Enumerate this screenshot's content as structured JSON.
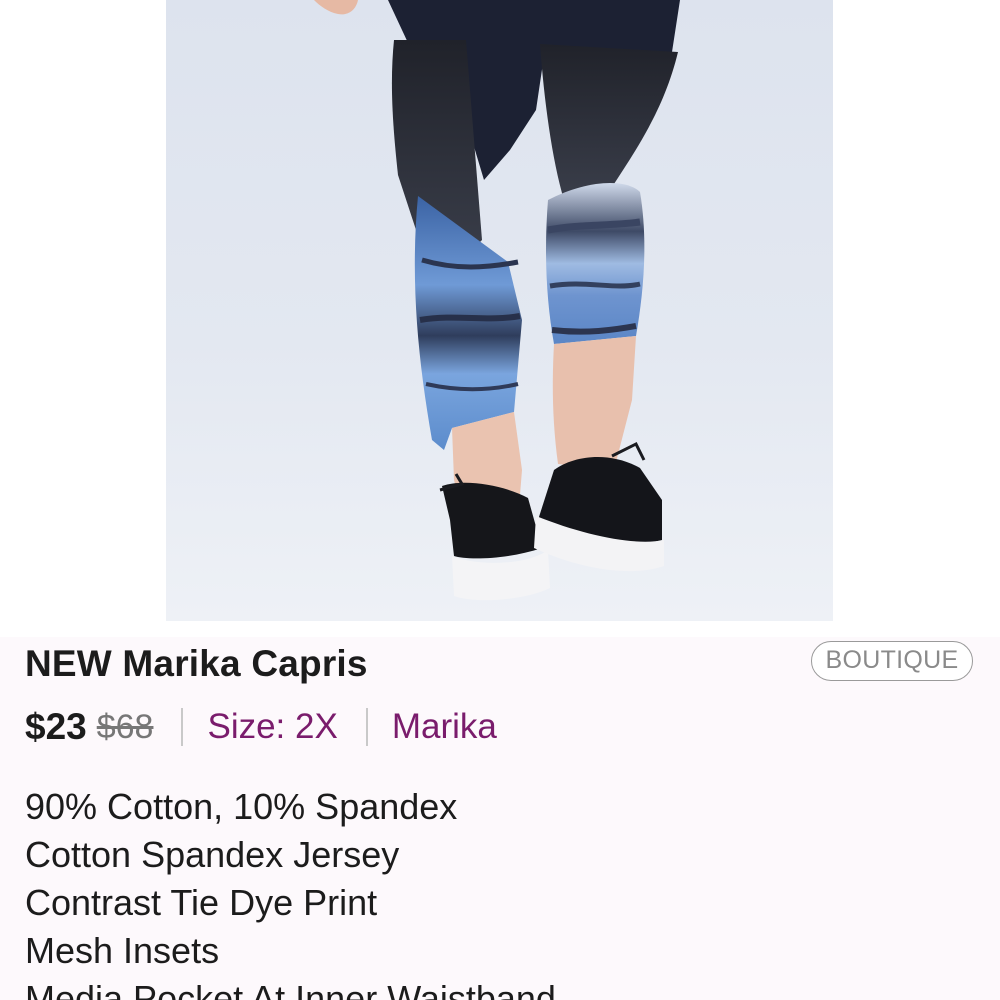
{
  "listing": {
    "title": "NEW Marika Capris",
    "badge": "BOUTIQUE",
    "price": "$23",
    "original_price": "$68",
    "size": "Size: 2X",
    "brand": "Marika",
    "description": [
      "90% Cotton, 10% Spandex",
      "Cotton Spandex Jersey",
      "Contrast Tie Dye Print",
      "Mesh Insets",
      "Media Pocket At Inner Waistband"
    ]
  },
  "colors": {
    "brand_accent": "#7a1c6c",
    "text": "#1c1c1c",
    "muted": "#777777",
    "panel_bg": "#fdf9fc"
  },
  "photo": {
    "subject": "product-photo-capri-leggings"
  }
}
